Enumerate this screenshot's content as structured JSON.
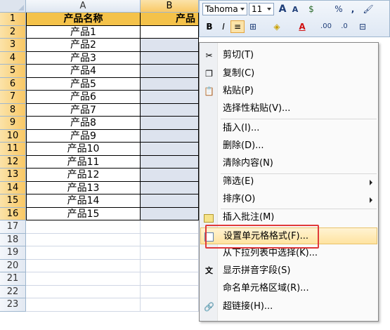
{
  "columns": [
    {
      "label": "A",
      "selected": false
    },
    {
      "label": "B",
      "selected": true
    }
  ],
  "rows": [
    "1",
    "2",
    "3",
    "4",
    "5",
    "6",
    "7",
    "8",
    "9",
    "10",
    "11",
    "12",
    "13",
    "14",
    "15",
    "16",
    "17",
    "18",
    "19",
    "20",
    "21",
    "22",
    "23"
  ],
  "header_cells": {
    "a": "产品名称",
    "b": "产品"
  },
  "products": [
    "产品1",
    "产品2",
    "产品3",
    "产品4",
    "产品5",
    "产品6",
    "产品7",
    "产品8",
    "产品9",
    "产品10",
    "产品11",
    "产品12",
    "产品13",
    "产品14",
    "产品15"
  ],
  "toolbar": {
    "font": "Tahoma",
    "size": "11",
    "grow_font": "A",
    "shrink_font": "A",
    "currency": "$",
    "percent": "%",
    "comma": ",",
    "format_painter": "🖌",
    "bold": "B",
    "italic": "I",
    "center": "≡",
    "borders": "⊞",
    "fill_color": "◈",
    "font_color": "A",
    "inc_decimal": ".00",
    "dec_decimal": ".0",
    "merge": "⊟"
  },
  "menu": {
    "cut": "剪切(T)",
    "copy": "复制(C)",
    "paste": "粘贴(P)",
    "paste_special": "选择性粘贴(V)...",
    "insert": "插入(I)...",
    "delete": "删除(D)...",
    "clear": "清除内容(N)",
    "filter": "筛选(E)",
    "sort": "排序(O)",
    "insert_comment": "插入批注(M)",
    "format_cells": "设置单元格格式(F)...",
    "pick_list": "从下拉列表中选择(K)...",
    "phonetic": "显示拼音字段(S)",
    "name_range": "命名单元格区域(R)...",
    "hyperlink": "超链接(H)..."
  },
  "colors": {
    "header_fill": "#f4c24a",
    "selected_fill": "#dde3ee",
    "highlight_border": "#e03a3a"
  }
}
